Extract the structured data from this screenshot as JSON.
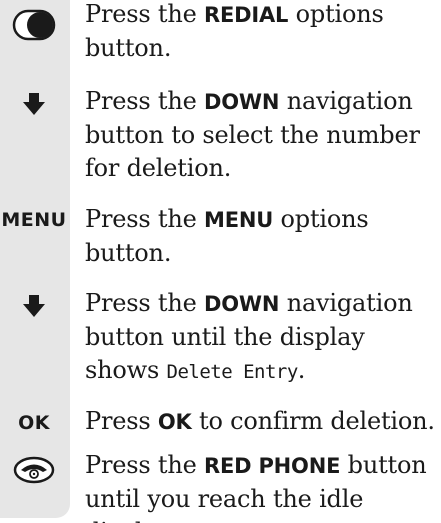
{
  "steps": [
    {
      "icon": "options-button-icon",
      "parts": [
        "Press the ",
        "REDIAL",
        " options button."
      ]
    },
    {
      "icon": "down-arrow-icon",
      "parts": [
        "Press the ",
        "DOWN",
        " navigation button to select the number for deletion."
      ]
    },
    {
      "icon": "menu-label",
      "icon_label": "MENU",
      "parts": [
        "Press the ",
        "MENU",
        " options button."
      ]
    },
    {
      "icon": "down-arrow-icon",
      "parts": [
        "Press the ",
        "DOWN",
        " navigation button until the display shows ",
        "Delete Entry",
        "."
      ]
    },
    {
      "icon": "ok-label",
      "icon_label": "OK",
      "parts": [
        "Press ",
        "OK",
        " to confirm deletion."
      ]
    },
    {
      "icon": "red-phone-icon",
      "parts": [
        "Press the ",
        "RED PHONE",
        " button until you reach the idle display."
      ]
    }
  ],
  "colors": {
    "sidebar": "#e6e6e6",
    "text": "#1a1a1a"
  }
}
